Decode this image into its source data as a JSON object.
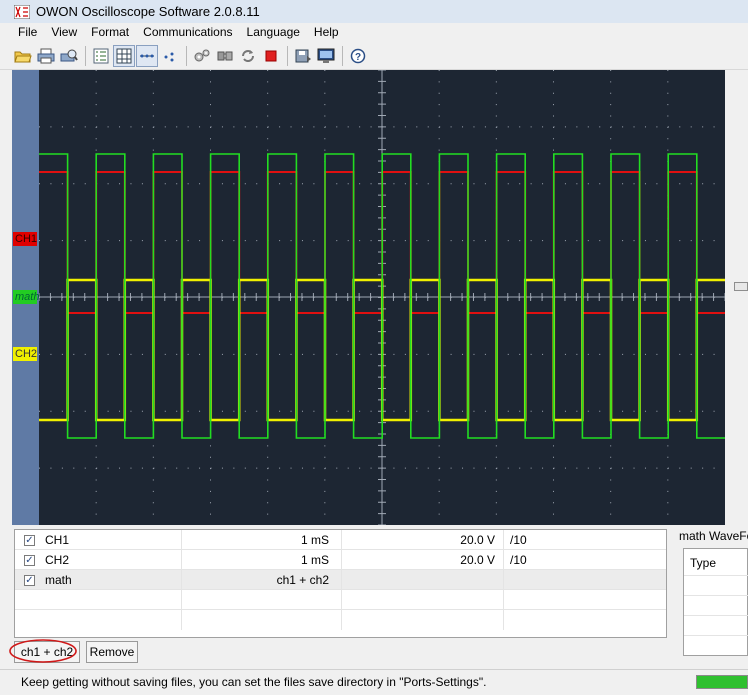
{
  "window": {
    "title": "OWON Oscilloscope Software 2.0.8.11"
  },
  "menu": [
    "File",
    "View",
    "Format",
    "Communications",
    "Language",
    "Help"
  ],
  "toolbar": {
    "icons": [
      "open-folder-icon",
      "print-icon",
      "print-preview-icon",
      "list-icon",
      "grid-icon",
      "dots-line-icon",
      "dots-icon",
      "gears-icon",
      "connect-icon",
      "refresh-icon",
      "stop-icon",
      "save-download-icon",
      "monitor-icon",
      "help-icon"
    ]
  },
  "scope": {
    "markers": {
      "ch1": "CH1",
      "math": "math",
      "ch2": "CH2"
    },
    "colors": {
      "ch1": "#e01010",
      "ch2": "#f0f000",
      "math": "#22dd22",
      "background": "#1d2633",
      "grid": "#a0a8b4"
    }
  },
  "channels": [
    {
      "name": "CH1",
      "checked": true,
      "timebase": "1  mS",
      "volts": "20.0 V",
      "probe": "/10"
    },
    {
      "name": "CH2",
      "checked": true,
      "timebase": "1  mS",
      "volts": "20.0 V",
      "probe": "/10"
    },
    {
      "name": "math",
      "checked": true,
      "expression": "ch1 + ch2"
    }
  ],
  "buttons": {
    "expression": "ch1 + ch2",
    "remove": "Remove"
  },
  "math_panel": {
    "title": "math WaveFo",
    "column": "Type"
  },
  "status": {
    "message": "Keep getting without saving files, you can set the files save directory in \"Ports-Settings\".",
    "progress": 1.0
  }
}
